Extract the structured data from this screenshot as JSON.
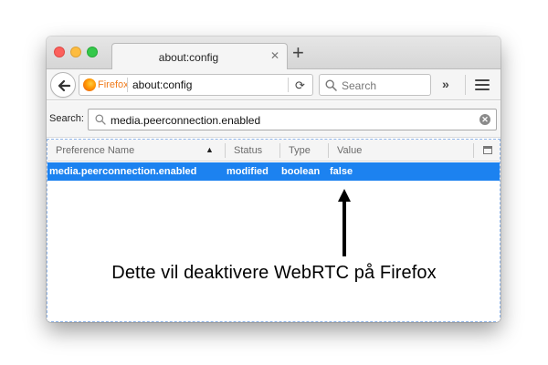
{
  "tab": {
    "title": "about:config",
    "close_glyph": "✕",
    "new_tab_glyph": "+"
  },
  "navbar": {
    "identity_label": "Firefox",
    "url": "about:config",
    "reload_glyph": "⟳",
    "search_placeholder": "Search",
    "overflow_glyph": "»"
  },
  "config_search": {
    "label": "Search:",
    "value": "media.peerconnection.enabled",
    "clear_glyph": "✕"
  },
  "table": {
    "columns": [
      "Preference Name",
      "Status",
      "Type",
      "Value"
    ],
    "sort_glyph": "▲",
    "rows": [
      {
        "name": "media.peerconnection.enabled",
        "status": "modified",
        "type": "boolean",
        "value": "false"
      }
    ],
    "selection_color": "#1c82f0"
  },
  "annotation": {
    "text": "Dette vil deaktivere WebRTC på Firefox"
  },
  "colors": {
    "traffic_close": "#fc605c",
    "traffic_minimize": "#fdbc40",
    "traffic_zoom": "#34c84a",
    "firefox_orange": "#f07a1a"
  }
}
